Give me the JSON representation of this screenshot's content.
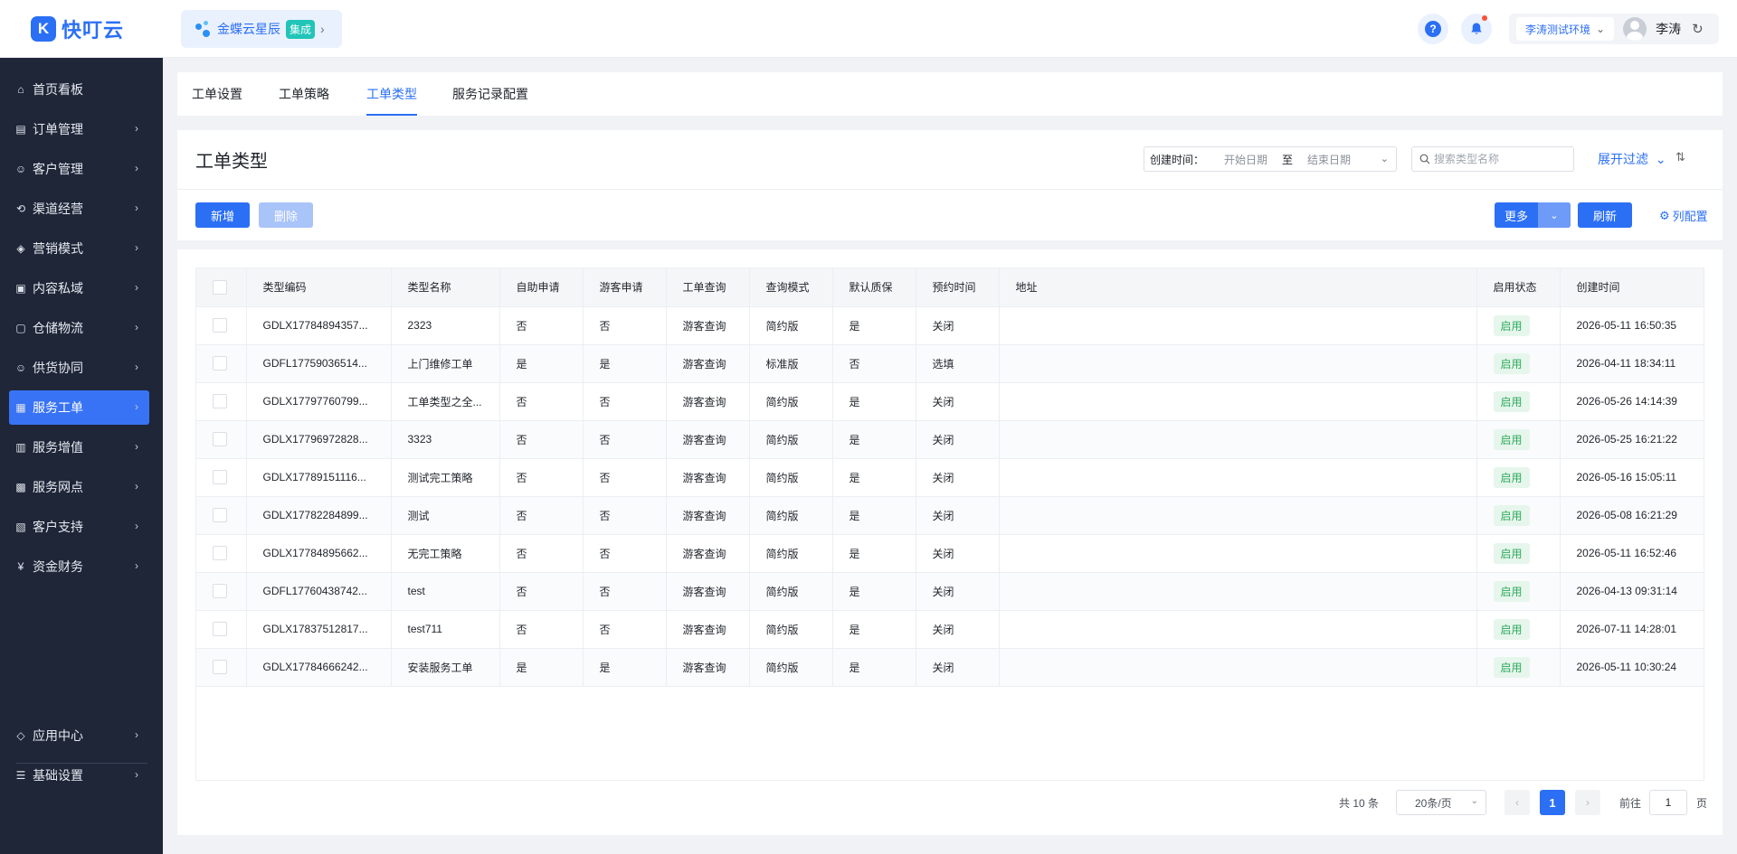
{
  "header": {
    "logo_mark": "K",
    "logo_text": "快叮云",
    "tenant_name": "金蝶云星辰",
    "tenant_badge": "集成",
    "env_label": "李涛测试环境",
    "user_name": "李涛"
  },
  "sidebar": {
    "items": [
      {
        "label": "首页看板",
        "icon": "home-icon",
        "glyph": "⌂",
        "arrow": false
      },
      {
        "label": "订单管理",
        "icon": "order-icon",
        "glyph": "▤",
        "arrow": true
      },
      {
        "label": "客户管理",
        "icon": "user-icon",
        "glyph": "☺",
        "arrow": true
      },
      {
        "label": "渠道经营",
        "icon": "channel-icon",
        "glyph": "⟲",
        "arrow": true
      },
      {
        "label": "营销模式",
        "icon": "tag-icon",
        "glyph": "◈",
        "arrow": true
      },
      {
        "label": "内容私域",
        "icon": "image-icon",
        "glyph": "▣",
        "arrow": true
      },
      {
        "label": "仓储物流",
        "icon": "warehouse-icon",
        "glyph": "▢",
        "arrow": true
      },
      {
        "label": "供货协同",
        "icon": "supply-icon",
        "glyph": "☺",
        "arrow": true
      },
      {
        "label": "服务工单",
        "icon": "ticket-icon",
        "glyph": "▦",
        "arrow": true,
        "active": true
      },
      {
        "label": "服务增值",
        "icon": "gift-icon",
        "glyph": "▥",
        "arrow": true
      },
      {
        "label": "服务网点",
        "icon": "store-icon",
        "glyph": "▩",
        "arrow": true
      },
      {
        "label": "客户支持",
        "icon": "support-icon",
        "glyph": "▧",
        "arrow": true
      },
      {
        "label": "资金财务",
        "icon": "yuan-icon",
        "glyph": "¥",
        "arrow": true
      }
    ],
    "bottom_items": [
      {
        "label": "应用中心",
        "icon": "cube-icon",
        "glyph": "◇"
      },
      {
        "label": "基础设置",
        "icon": "settings-list-icon",
        "glyph": "☰"
      }
    ]
  },
  "tabs": [
    "工单设置",
    "工单策略",
    "工单类型",
    "服务记录配置"
  ],
  "active_tab": 2,
  "filter": {
    "page_title": "工单类型",
    "date_label": "创建时间：",
    "date_start": "开始日期",
    "date_sep": "至",
    "date_end": "结束日期",
    "search_placeholder": "搜索类型名称",
    "expand_label": "展开过滤",
    "add_label": "新增",
    "delete_label": "删除",
    "more_label": "更多",
    "refresh_label": "刷新",
    "col_config_label": "列配置"
  },
  "table": {
    "columns": [
      "类型编码",
      "类型名称",
      "自助申请",
      "游客申请",
      "工单查询",
      "查询模式",
      "默认质保",
      "预约时间",
      "地址",
      "启用状态",
      "创建时间"
    ],
    "rows": [
      [
        "GDLX17784894357...",
        "2323",
        "否",
        "否",
        "游客查询",
        "简约版",
        "是",
        "关闭",
        "",
        "启用",
        "2026-05-11 16:50:35"
      ],
      [
        "GDFL17759036514...",
        "上门维修工单",
        "是",
        "是",
        "游客查询",
        "标准版",
        "否",
        "选填",
        "",
        "启用",
        "2026-04-11 18:34:11"
      ],
      [
        "GDLX17797760799...",
        "工单类型之全...",
        "否",
        "否",
        "游客查询",
        "简约版",
        "是",
        "关闭",
        "",
        "启用",
        "2026-05-26 14:14:39"
      ],
      [
        "GDLX17796972828...",
        "3323",
        "否",
        "否",
        "游客查询",
        "简约版",
        "是",
        "关闭",
        "",
        "启用",
        "2026-05-25 16:21:22"
      ],
      [
        "GDLX17789151116...",
        "测试完工策略",
        "否",
        "否",
        "游客查询",
        "简约版",
        "是",
        "关闭",
        "",
        "启用",
        "2026-05-16 15:05:11"
      ],
      [
        "GDLX17782284899...",
        "测试",
        "否",
        "否",
        "游客查询",
        "简约版",
        "是",
        "关闭",
        "",
        "启用",
        "2026-05-08 16:21:29"
      ],
      [
        "GDLX17784895662...",
        "无完工策略",
        "否",
        "否",
        "游客查询",
        "简约版",
        "是",
        "关闭",
        "",
        "启用",
        "2026-05-11 16:52:46"
      ],
      [
        "GDFL17760438742...",
        "test",
        "否",
        "否",
        "游客查询",
        "简约版",
        "是",
        "关闭",
        "",
        "启用",
        "2026-04-13 09:31:14"
      ],
      [
        "GDLX17837512817...",
        "test711",
        "否",
        "否",
        "游客查询",
        "简约版",
        "是",
        "关闭",
        "",
        "启用",
        "2026-07-11 14:28:01"
      ],
      [
        "GDLX17784666242...",
        "安装服务工单",
        "是",
        "是",
        "游客查询",
        "简约版",
        "是",
        "关闭",
        "",
        "启用",
        "2026-05-11 10:30:24"
      ]
    ]
  },
  "pagination": {
    "total": "共 10 条",
    "page_size": "20条/页",
    "current": "1",
    "goto_label": "前往",
    "goto_value": "1",
    "goto_suffix": "页"
  },
  "colors": {
    "primary": "#2b6ff5",
    "sidebar_bg": "#1e2638",
    "status_green": "#2eaa5c"
  }
}
